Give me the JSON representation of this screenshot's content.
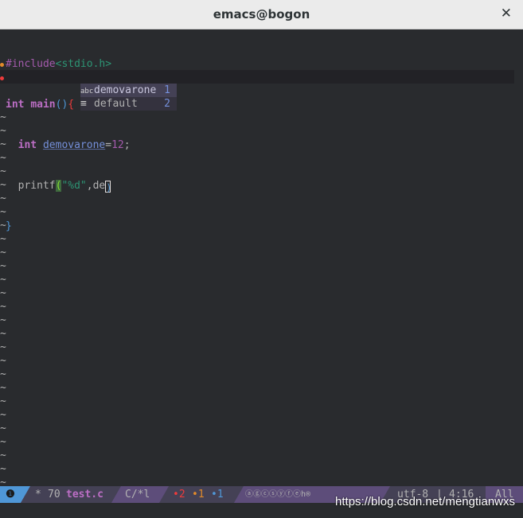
{
  "window": {
    "title": "emacs@bogon",
    "close_glyph": "✕"
  },
  "code": {
    "line1": {
      "include": "#include",
      "header": "<stdio.h>"
    },
    "line2": {
      "type": "int",
      "name": "main",
      "parens": "()",
      "brace": "{"
    },
    "line3": {
      "type": "int",
      "var": "demovarone",
      "eq": "=",
      "num": "12",
      "semi": ";"
    },
    "line4": {
      "call": "printf",
      "open": "(",
      "fmt": "\"%d\"",
      "comma": ",",
      "typed": "de",
      "close": ")"
    },
    "line5": {
      "brace": "}"
    }
  },
  "completion": {
    "items": [
      {
        "icon": "abc",
        "label": "demovarone",
        "index": "1"
      },
      {
        "icon": "≡",
        "label": "default",
        "index": "2"
      }
    ]
  },
  "fringe": {
    "tilde": "~"
  },
  "modeline": {
    "info": "❶",
    "modified": "*",
    "size": "70",
    "filename": "test.c",
    "mode": "C/*l",
    "err": "•2",
    "warn": "•1",
    "note": "•1",
    "minor": "ⓐⓖⓒⓢⓨⓕⓔh®",
    "encoding": "utf-8",
    "position": "4:16",
    "scroll": "All"
  },
  "watermark": "https://blog.csdn.net/mengtianwxs",
  "colors": {
    "background": "#292b2e",
    "modeline": "#5d4d7a",
    "keyword": "#bc6ec5",
    "string": "#2d9574",
    "error": "#ef3b3b",
    "warning": "#e18a2a",
    "info": "#4f97d7"
  }
}
